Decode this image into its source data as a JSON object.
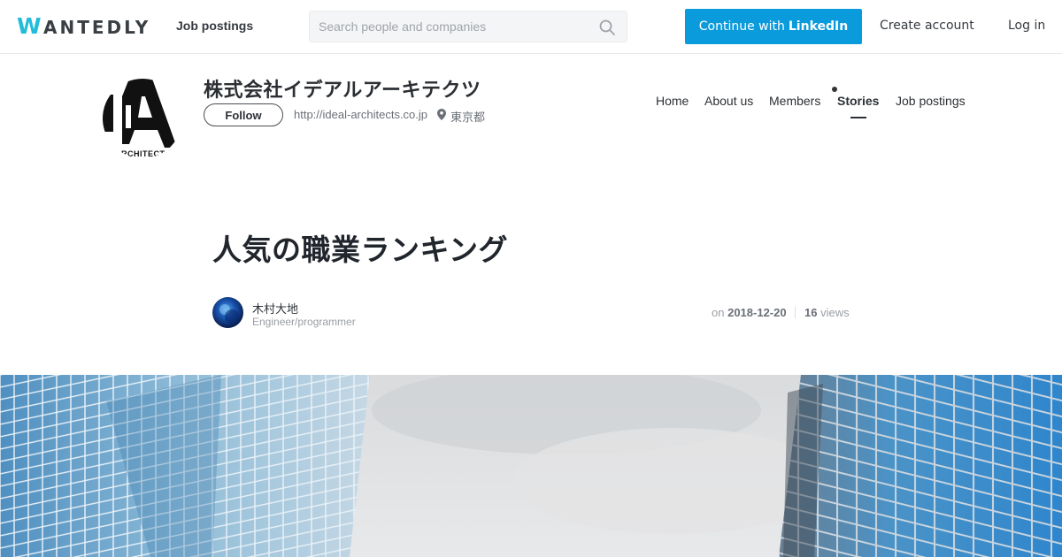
{
  "topbar": {
    "logo_first": "W",
    "logo_rest": "ANTEDLY",
    "nav_job_postings": "Job postings",
    "search": {
      "placeholder": "Search people and companies",
      "value": ""
    },
    "linkedin_prefix": "Continue with",
    "linkedin_brand": "LinkedIn",
    "create_account": "Create account",
    "login": "Log in",
    "accent_color": "#0a9bdc",
    "logo_color": "#21bddb"
  },
  "company": {
    "name": "株式会社イデアルアーキテクツ",
    "follow_label": "Follow",
    "url": "http://ideal-architects.co.jp",
    "location": "東京都",
    "logo_text": "ARCHITECTS",
    "logo_icon": "company-logo",
    "nav": [
      {
        "label": "Home",
        "active": false
      },
      {
        "label": "About us",
        "active": false
      },
      {
        "label": "Members",
        "active": false
      },
      {
        "label": "Stories",
        "active": true
      },
      {
        "label": "Job postings",
        "active": false
      }
    ]
  },
  "story": {
    "title": "人気の職業ランキング",
    "author": {
      "name": "木村大地",
      "role": "Engineer/programmer"
    },
    "date_prefix": "on",
    "date": "2018-12-20",
    "views_count": "16",
    "views_label": "views",
    "hero_image": "skyscrapers-sky-photo"
  }
}
